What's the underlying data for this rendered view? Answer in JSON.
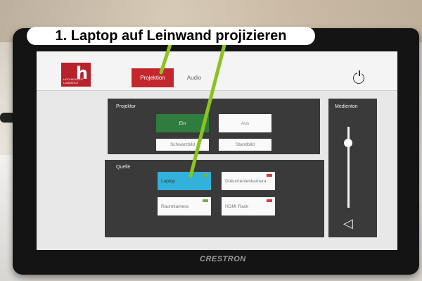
{
  "annotation": {
    "text": "1. Laptop auf Leinwand projizieren",
    "line_color": "#8dc21f"
  },
  "header": {
    "logo_text": "HOCHSCHULE LANDSHUT",
    "logo_letter": "h",
    "tabs": [
      {
        "label": "Projektion",
        "active": true
      },
      {
        "label": "Audio",
        "active": false
      }
    ],
    "power_icon": "power-icon"
  },
  "projector": {
    "title": "Projektor",
    "on_label": "Ein",
    "off_label": "Aus",
    "black_label": "Schwarzbild",
    "still_label": "Standbild"
  },
  "source": {
    "title": "Quelle",
    "items": [
      {
        "label": "Laptop",
        "selected": true,
        "status_color": "#7ab23a"
      },
      {
        "label": "Dokumentenkamera",
        "selected": false,
        "status_color": "#d93a3a"
      },
      {
        "label": "Raumkamera",
        "selected": false,
        "status_color": "#7ab23a"
      },
      {
        "label": "HDMI Rack",
        "selected": false,
        "status_color": "#d93a3a"
      }
    ]
  },
  "audio": {
    "title": "Medienton",
    "level_percent": 84,
    "speaker_icon": "speaker-icon"
  },
  "device_brand": "CRESTRON",
  "colors": {
    "accent_red": "#c4262e",
    "on_green": "#2f7d3e",
    "selected_blue": "#32b1da"
  }
}
